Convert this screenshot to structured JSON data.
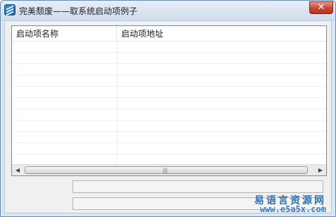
{
  "window": {
    "title": "完美颓废——取系统启动项例子",
    "close_label": "✕"
  },
  "listview": {
    "columns": [
      "启动项名称",
      "启动项地址"
    ],
    "rows": []
  },
  "scrollbar": {
    "left_arrow": "◀",
    "right_arrow": "▶",
    "grip": "|||"
  },
  "fields": {
    "field1_value": "",
    "field2_value": ""
  },
  "watermark": {
    "line1": "易语言资源网",
    "line2": "www.e5a5x.com"
  },
  "colors": {
    "accent": "#2f6fb4",
    "close": "#c74a36"
  }
}
